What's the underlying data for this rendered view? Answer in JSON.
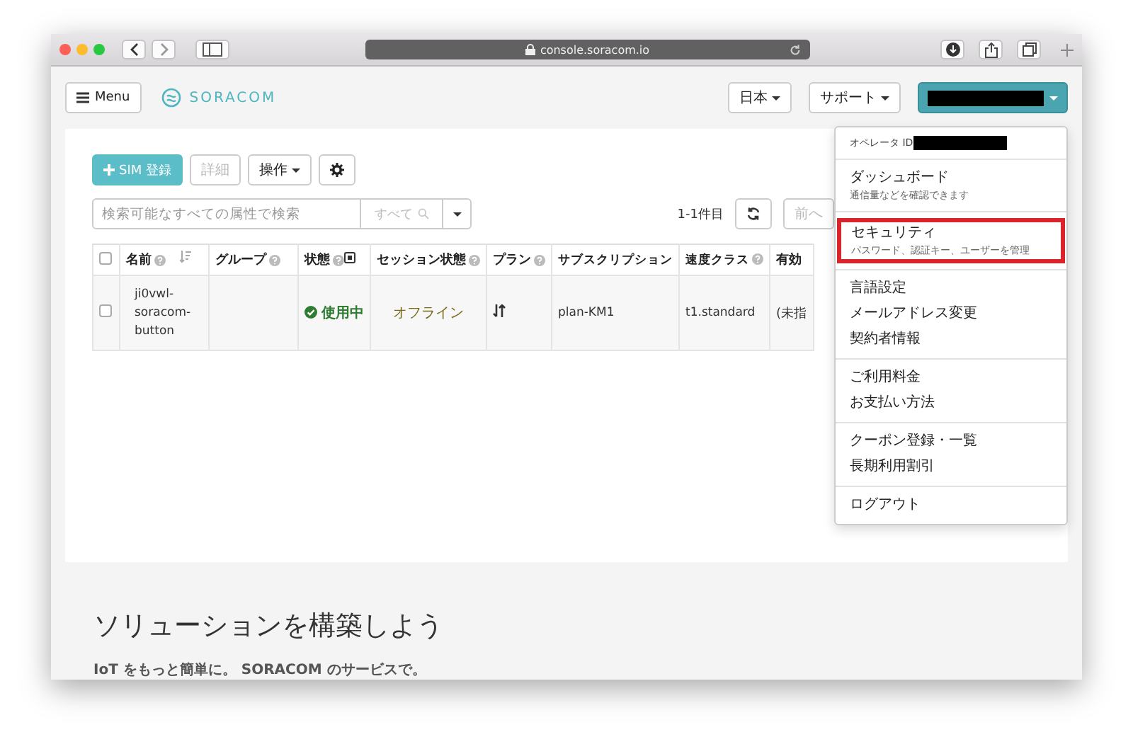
{
  "browser": {
    "url": "console.soracom.io"
  },
  "nav": {
    "menu_label": "Menu",
    "logo": "SORACOM",
    "language": "日本",
    "support": "サポート"
  },
  "toolbar": {
    "register": "SIM 登録",
    "details": {
      "label": "詳細",
      "disabled": true
    },
    "actions": "操作"
  },
  "search": {
    "placeholder": "検索可能なすべての属性で検索",
    "scope": "すべて"
  },
  "pagination": {
    "range": "1-1件目",
    "prev": {
      "label": "前へ",
      "disabled": true
    }
  },
  "table": {
    "header_checked": false,
    "columns": [
      {
        "label": "名前",
        "help": true,
        "sortable": true
      },
      {
        "label": "グループ",
        "help": true,
        "sortable": false
      },
      {
        "label": "状態",
        "help": true,
        "sortable": false,
        "filter": true
      },
      {
        "label": "セッション状態",
        "help": true,
        "sortable": false
      },
      {
        "label": "プラン",
        "help": true,
        "sortable": false
      },
      {
        "label": "サブスクリプション",
        "help": false,
        "sortable": false
      },
      {
        "label": "速度クラス",
        "help": true,
        "sortable": false
      },
      {
        "label": "有効",
        "help": false,
        "sortable": false
      }
    ],
    "rows": [
      {
        "checked": false,
        "name": "ji0vwl-soracom-button",
        "status": "使用中",
        "session": "オフライン",
        "subscription": "plan-KM1",
        "speed": "t1.standard",
        "expiry": "(未指"
      }
    ]
  },
  "menu": {
    "operator_label": "オペレータ ID",
    "sections": [
      [
        {
          "label": "ダッシュボード",
          "description": "通信量などを確認できます",
          "highlighted": false
        }
      ],
      [
        {
          "label": "セキュリティ",
          "description": "パスワード、認証キー、ユーザーを管理",
          "highlighted": true
        }
      ],
      [
        {
          "label": "言語設定",
          "highlighted": false
        },
        {
          "label": "メールアドレス変更",
          "highlighted": false
        },
        {
          "label": "契約者情報",
          "highlighted": false
        }
      ],
      [
        {
          "label": "ご利用料金",
          "highlighted": false
        },
        {
          "label": "お支払い方法",
          "highlighted": false
        }
      ],
      [
        {
          "label": "クーポン登録・一覧",
          "highlighted": false
        },
        {
          "label": "長期利用割引",
          "highlighted": false
        }
      ],
      [
        {
          "label": "ログアウト",
          "highlighted": false
        }
      ]
    ]
  },
  "hero": {
    "title": "ソリューションを構築しよう",
    "subtitle": "IoT をもっと簡単に。 SORACOM のサービスで。"
  }
}
